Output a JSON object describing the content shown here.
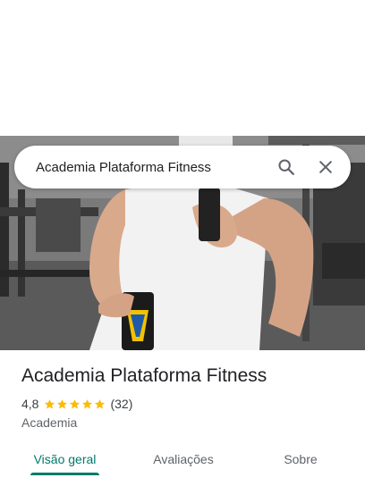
{
  "search": {
    "query": "Academia Plataforma Fitness"
  },
  "place": {
    "name": "Academia Plataforma Fitness",
    "rating": "4,8",
    "rating_value": 4.8,
    "review_count": "(32)",
    "category": "Academia"
  },
  "tabs": [
    {
      "label": "Visão geral",
      "active": true
    },
    {
      "label": "Avaliações",
      "active": false
    },
    {
      "label": "Sobre",
      "active": false
    }
  ],
  "colors": {
    "accent": "#00796b",
    "star": "#fbbc04",
    "text": "#202124",
    "secondary_text": "#5f6368"
  },
  "icons": {
    "search": "search-icon",
    "close": "close-icon",
    "star": "star-icon"
  }
}
